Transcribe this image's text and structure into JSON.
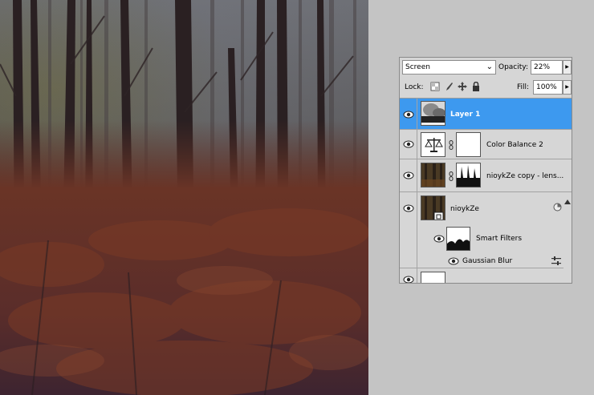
{
  "layers_panel": {
    "blend_mode": "Screen",
    "opacity_label": "Opacity:",
    "opacity_value": "22%",
    "lock_label": "Lock:",
    "fill_label": "Fill:",
    "fill_value": "100%",
    "layers": [
      {
        "name": "Layer 1",
        "selected": true
      },
      {
        "name": "Color Balance 2",
        "selected": false
      },
      {
        "name": "nioykZe copy - lens...",
        "selected": false
      },
      {
        "name": "nioykZe",
        "selected": false
      }
    ],
    "smart_filters_label": "Smart Filters",
    "filter_name": "Gaussian Blur"
  },
  "colors": {
    "selection": "#3d99ef",
    "panel_bg": "#d6d6d6",
    "workspace_bg": "#c4c4c4"
  }
}
